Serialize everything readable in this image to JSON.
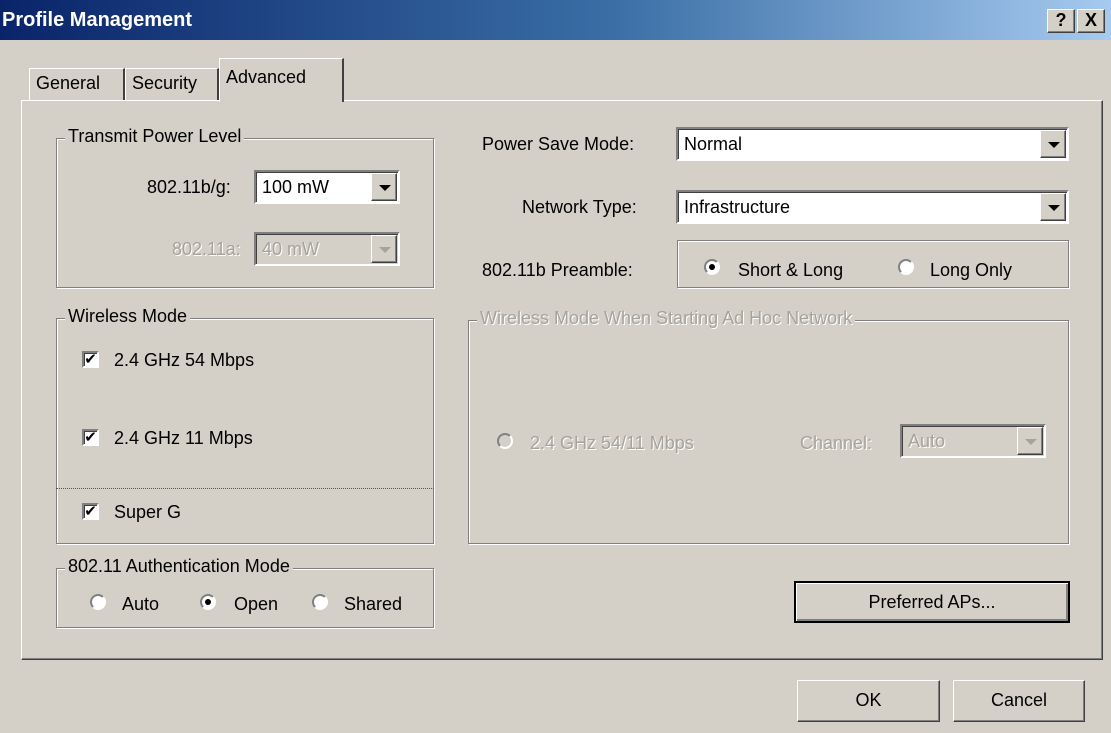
{
  "window": {
    "title": "Profile Management"
  },
  "titlebar": {
    "help_label": "?",
    "close_label": "X"
  },
  "tabs": [
    {
      "label": "General",
      "selected": false
    },
    {
      "label": "Security",
      "selected": false
    },
    {
      "label": "Advanced",
      "selected": true
    }
  ],
  "transmit_power": {
    "legend": "Transmit Power Level",
    "bg_label": "802.11b/g:",
    "bg_value": "100 mW",
    "a_label": "802.11a:",
    "a_value": "40 mW"
  },
  "power_save": {
    "label": "Power Save Mode:",
    "value": "Normal"
  },
  "network_type": {
    "label": "Network Type:",
    "value": "Infrastructure"
  },
  "preamble": {
    "label": "802.11b Preamble:",
    "options": [
      {
        "label": "Short & Long",
        "selected": true
      },
      {
        "label": "Long Only",
        "selected": false
      }
    ]
  },
  "wireless_mode": {
    "legend": "Wireless Mode",
    "options": [
      {
        "label": "2.4 GHz 54 Mbps",
        "checked": true
      },
      {
        "label": "2.4 GHz 11 Mbps",
        "checked": true
      }
    ],
    "super_g": {
      "label": "Super G",
      "checked": true
    }
  },
  "adhoc": {
    "legend": "Wireless Mode When Starting Ad Hoc Network",
    "option_label": "2.4 GHz 54/11 Mbps",
    "channel_label": "Channel:",
    "channel_value": "Auto"
  },
  "auth_mode": {
    "legend": "802.11 Authentication Mode",
    "options": [
      {
        "label": "Auto",
        "selected": false
      },
      {
        "label": "Open",
        "selected": true
      },
      {
        "label": "Shared",
        "selected": false
      }
    ]
  },
  "buttons": {
    "preferred_aps": "Preferred APs...",
    "ok": "OK",
    "cancel": "Cancel"
  },
  "check_glyph": "✔"
}
